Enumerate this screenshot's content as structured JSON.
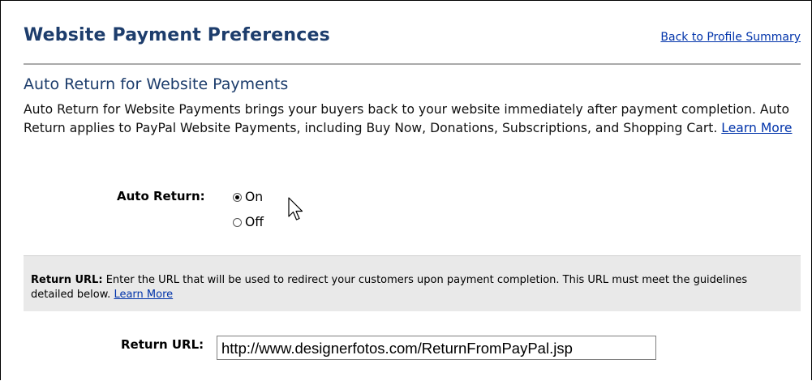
{
  "header": {
    "title": "Website Payment Preferences",
    "back_link": "Back to Profile Summary"
  },
  "auto_return_section": {
    "title": "Auto Return for Website Payments",
    "description": "Auto Return for Website Payments brings your buyers back to your website immediately after payment completion. Auto Return applies to PayPal Website Payments, including Buy Now, Donations, Subscriptions, and Shopping Cart.",
    "learn_more": "Learn More",
    "field_label": "Auto Return:",
    "options": [
      {
        "label": "On",
        "selected": true
      },
      {
        "label": "Off",
        "selected": false
      }
    ]
  },
  "return_url_section": {
    "note_label": "Return URL:",
    "note_text": "Enter the URL that will be used to redirect your customers upon payment completion. This URL must meet the guidelines detailed below.",
    "learn_more": "Learn More",
    "field_label": "Return URL:",
    "value": "http://www.designerfotos.com/ReturnFromPayPal.jsp"
  },
  "icons": {
    "cursor": "mouse-pointer-icon"
  }
}
